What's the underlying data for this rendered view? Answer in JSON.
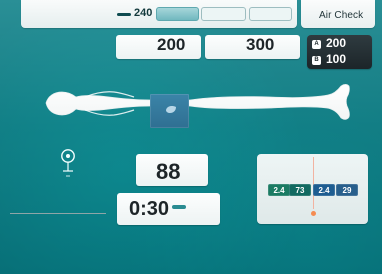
{
  "header": {
    "level": "240",
    "tabs": [
      {
        "label": "",
        "active": true
      },
      {
        "label": "",
        "active": false
      },
      {
        "label": "",
        "active": false
      }
    ],
    "air_check_label": "Air Check"
  },
  "settings": {
    "left_value": "200",
    "right_value": "300"
  },
  "ab_panel": {
    "a_label": "A",
    "a_value": "200",
    "b_label": "B",
    "b_value": "100"
  },
  "readouts": {
    "temperature_value": "88",
    "timer_value": "0:30"
  },
  "graph": {
    "segments": [
      "2.4",
      "73",
      "2.4",
      "29"
    ]
  }
}
